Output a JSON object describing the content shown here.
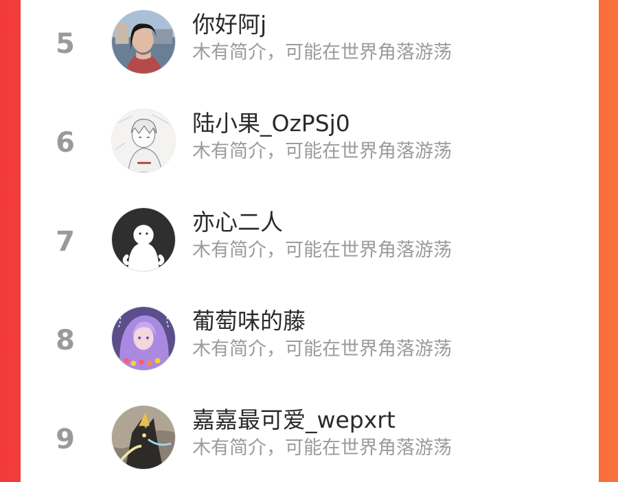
{
  "colors": {
    "background_left": "#f23a3a",
    "background_right": "#f8703b",
    "panel": "#ffffff",
    "rank_text": "#9a9a9a",
    "name_text": "#2a2a2a",
    "bio_text": "#9b9b9b"
  },
  "ranking": {
    "rows": [
      {
        "rank": "5",
        "name": "你好阿j",
        "bio": "木有简介，可能在世界角落游荡",
        "avatar": "avatar-photo-girl-icon"
      },
      {
        "rank": "6",
        "name": "陆小果_OzPSj0",
        "bio": "木有简介，可能在世界角落游荡",
        "avatar": "avatar-sketch-girl-icon"
      },
      {
        "rank": "7",
        "name": "亦心二人",
        "bio": "木有简介，可能在世界角落游荡",
        "avatar": "avatar-ghost-icon"
      },
      {
        "rank": "8",
        "name": "葡萄味的藤",
        "bio": "木有简介，可能在世界角落游荡",
        "avatar": "avatar-anime-purple-icon"
      },
      {
        "rank": "9",
        "name": "嘉嘉最可爱_wepxrt",
        "bio": "木有简介，可能在世界角落游荡",
        "avatar": "avatar-game-hero-icon"
      }
    ]
  }
}
